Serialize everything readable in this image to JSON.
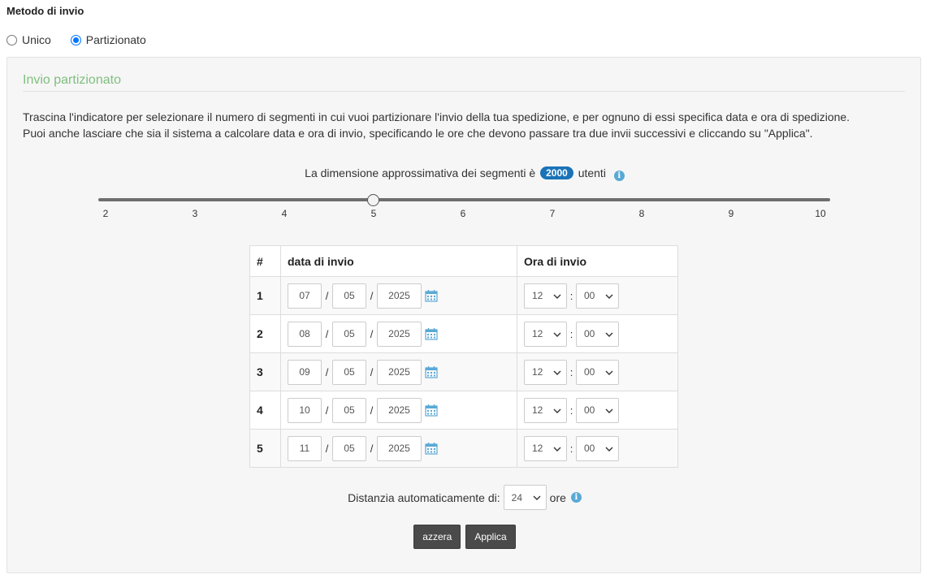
{
  "method": {
    "title": "Metodo di invio",
    "options": [
      {
        "label": "Unico",
        "checked": false
      },
      {
        "label": "Partizionato",
        "checked": true
      }
    ]
  },
  "panel": {
    "title": "Invio partizionato",
    "description_line1": "Trascina l'indicatore per selezionare il numero di segmenti in cui vuoi partizionare l'invio della tua spedizione, e per ognuno di essi specifica data e ora di spedizione.",
    "description_line2": "Puoi anche lasciare che sia il sistema a calcolare data e ora di invio, specificando le ore che devono passare tra due invii successivi e cliccando su \"Applica\"."
  },
  "segment_size": {
    "prefix": "La dimensione approssimativa dei segmenti è",
    "value": "2000",
    "suffix": "utenti",
    "icon": "info-icon"
  },
  "slider": {
    "min": 2,
    "max": 10,
    "value": 5,
    "ticks": [
      "2",
      "3",
      "4",
      "5",
      "6",
      "7",
      "8",
      "9",
      "10"
    ]
  },
  "table": {
    "headers": [
      "#",
      "data di invio",
      "Ora di invio"
    ],
    "rows": [
      {
        "num": "1",
        "day": "07",
        "month": "05",
        "year": "2025",
        "hour": "12",
        "minute": "00"
      },
      {
        "num": "2",
        "day": "08",
        "month": "05",
        "year": "2025",
        "hour": "12",
        "minute": "00"
      },
      {
        "num": "3",
        "day": "09",
        "month": "05",
        "year": "2025",
        "hour": "12",
        "minute": "00"
      },
      {
        "num": "4",
        "day": "10",
        "month": "05",
        "year": "2025",
        "hour": "12",
        "minute": "00"
      },
      {
        "num": "5",
        "day": "11",
        "month": "05",
        "year": "2025",
        "hour": "12",
        "minute": "00"
      }
    ],
    "date_separator": "/",
    "time_separator": ":",
    "calendar_icon": "calendar-icon"
  },
  "auto_distance": {
    "label": "Distanzia automaticamente di:",
    "value": "24",
    "unit": "ore",
    "icon": "info-icon"
  },
  "buttons": {
    "reset": "azzera",
    "apply": "Applica"
  },
  "colors": {
    "panel_title": "#7fbf7f",
    "badge": "#1a73b8",
    "radio_accent": "#0075ff",
    "button_bg": "#4a4a4a",
    "info_icon": "#5aa9d6",
    "calendar_icon": "#5aa9d6"
  }
}
